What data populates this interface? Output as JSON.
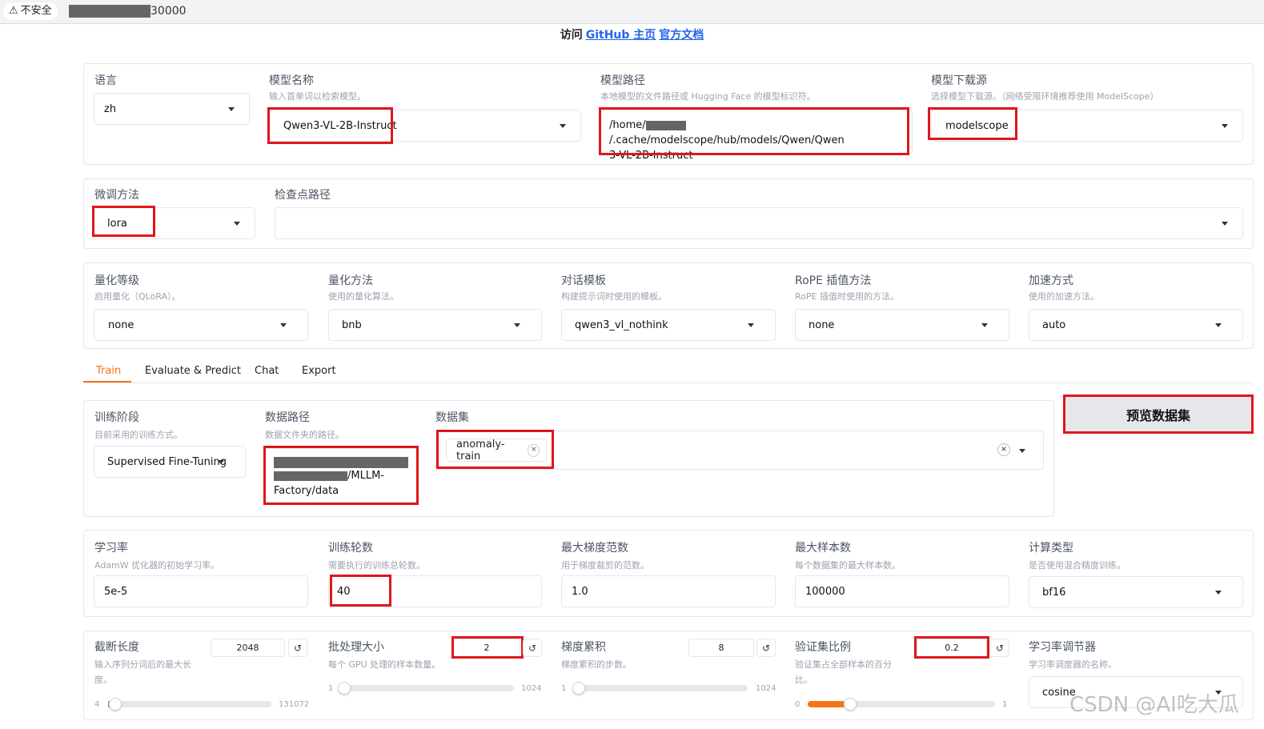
{
  "browser": {
    "security_label": "不安全",
    "url_suffix": "30000"
  },
  "header": {
    "visit": "访问",
    "github_link": "GitHub 主页",
    "docs_link": "官方文档"
  },
  "row1": {
    "lang": {
      "label": "语言",
      "value": "zh"
    },
    "model_name": {
      "label": "模型名称",
      "info": "输入首单词以检索模型。",
      "value": "Qwen3-VL-2B-Instruct"
    },
    "model_path": {
      "label": "模型路径",
      "info": "本地模型的文件路径或 Hugging Face 的模型标识符。",
      "value_line1": "/home/",
      "value_line1b": "/.cache/modelscope/hub/models/Qwen/Qwen",
      "value_line2": "3-VL-2B-Instruct"
    },
    "hub": {
      "label": "模型下载源",
      "info": "选择模型下载源。（网络受限环境推荐使用 ModelScope）",
      "value": "modelscope"
    }
  },
  "row2": {
    "finetune": {
      "label": "微调方法",
      "value": "lora"
    },
    "checkpoint": {
      "label": "检查点路径",
      "value": ""
    }
  },
  "row3": {
    "quant_bit": {
      "label": "量化等级",
      "info": "启用量化（QLoRA）。",
      "value": "none"
    },
    "quant_method": {
      "label": "量化方法",
      "info": "使用的量化算法。",
      "value": "bnb"
    },
    "template": {
      "label": "对话模板",
      "info": "构建提示词时使用的模板。",
      "value": "qwen3_vl_nothink"
    },
    "rope": {
      "label": "RoPE 插值方法",
      "info": "RoPE 插值时使用的方法。",
      "value": "none"
    },
    "booster": {
      "label": "加速方式",
      "info": "使用的加速方法。",
      "value": "auto"
    }
  },
  "tabs": [
    "Train",
    "Evaluate & Predict",
    "Chat",
    "Export"
  ],
  "train": {
    "stage": {
      "label": "训练阶段",
      "info": "目前采用的训练方式。",
      "value": "Supervised Fine-Tuning"
    },
    "dataset_dir": {
      "label": "数据路径",
      "info": "数据文件夹的路径。",
      "value_line2": "/MLLM-",
      "value_line3": "Factory/data"
    },
    "dataset": {
      "label": "数据集",
      "chip": "anomaly-train",
      "chip_close": "×",
      "clear": "×"
    },
    "preview_button": "预览数据集"
  },
  "row5": {
    "lr": {
      "label": "学习率",
      "info": "AdamW 优化器的初始学习率。",
      "value": "5e-5"
    },
    "epochs": {
      "label": "训练轮数",
      "info": "需要执行的训练总轮数。",
      "value": "40"
    },
    "max_grad_norm": {
      "label": "最大梯度范数",
      "info": "用于梯度裁剪的范数。",
      "value": "1.0"
    },
    "max_samples": {
      "label": "最大样本数",
      "info": "每个数据集的最大样本数。",
      "value": "100000"
    },
    "compute_type": {
      "label": "计算类型",
      "info": "是否使用混合精度训练。",
      "value": "bf16"
    }
  },
  "row6": {
    "cutoff_len": {
      "label": "截断长度",
      "info_line1": "输入序列分词后的最大长",
      "info_line2": "度。",
      "value": "2048",
      "min": "4",
      "max": "131072",
      "level": 0.0156
    },
    "batch_size": {
      "label": "批处理大小",
      "info": "每个 GPU 处理的样本数量。",
      "value": "2",
      "min": "1",
      "max": "1024",
      "level": 0.001
    },
    "grad_accum": {
      "label": "梯度累积",
      "info": "梯度累积的步数。",
      "value": "8",
      "min": "1",
      "max": "1024",
      "level": 0.0068
    },
    "val_size": {
      "label": "验证集比例",
      "info_line1": "验证集占全部样本的百分",
      "info_line2": "比。",
      "value": "0.2",
      "min": "0",
      "max": "1",
      "level": 0.2
    },
    "lr_scheduler": {
      "label": "学习率调节器",
      "info": "学习率调度器的名称。",
      "value": "cosine"
    },
    "reset_glyph": "↺"
  },
  "watermark": "CSDN @AI吃大瓜",
  "colors": {
    "accent": "#f97316",
    "highlight": "#e0161e",
    "link": "#2563eb"
  }
}
